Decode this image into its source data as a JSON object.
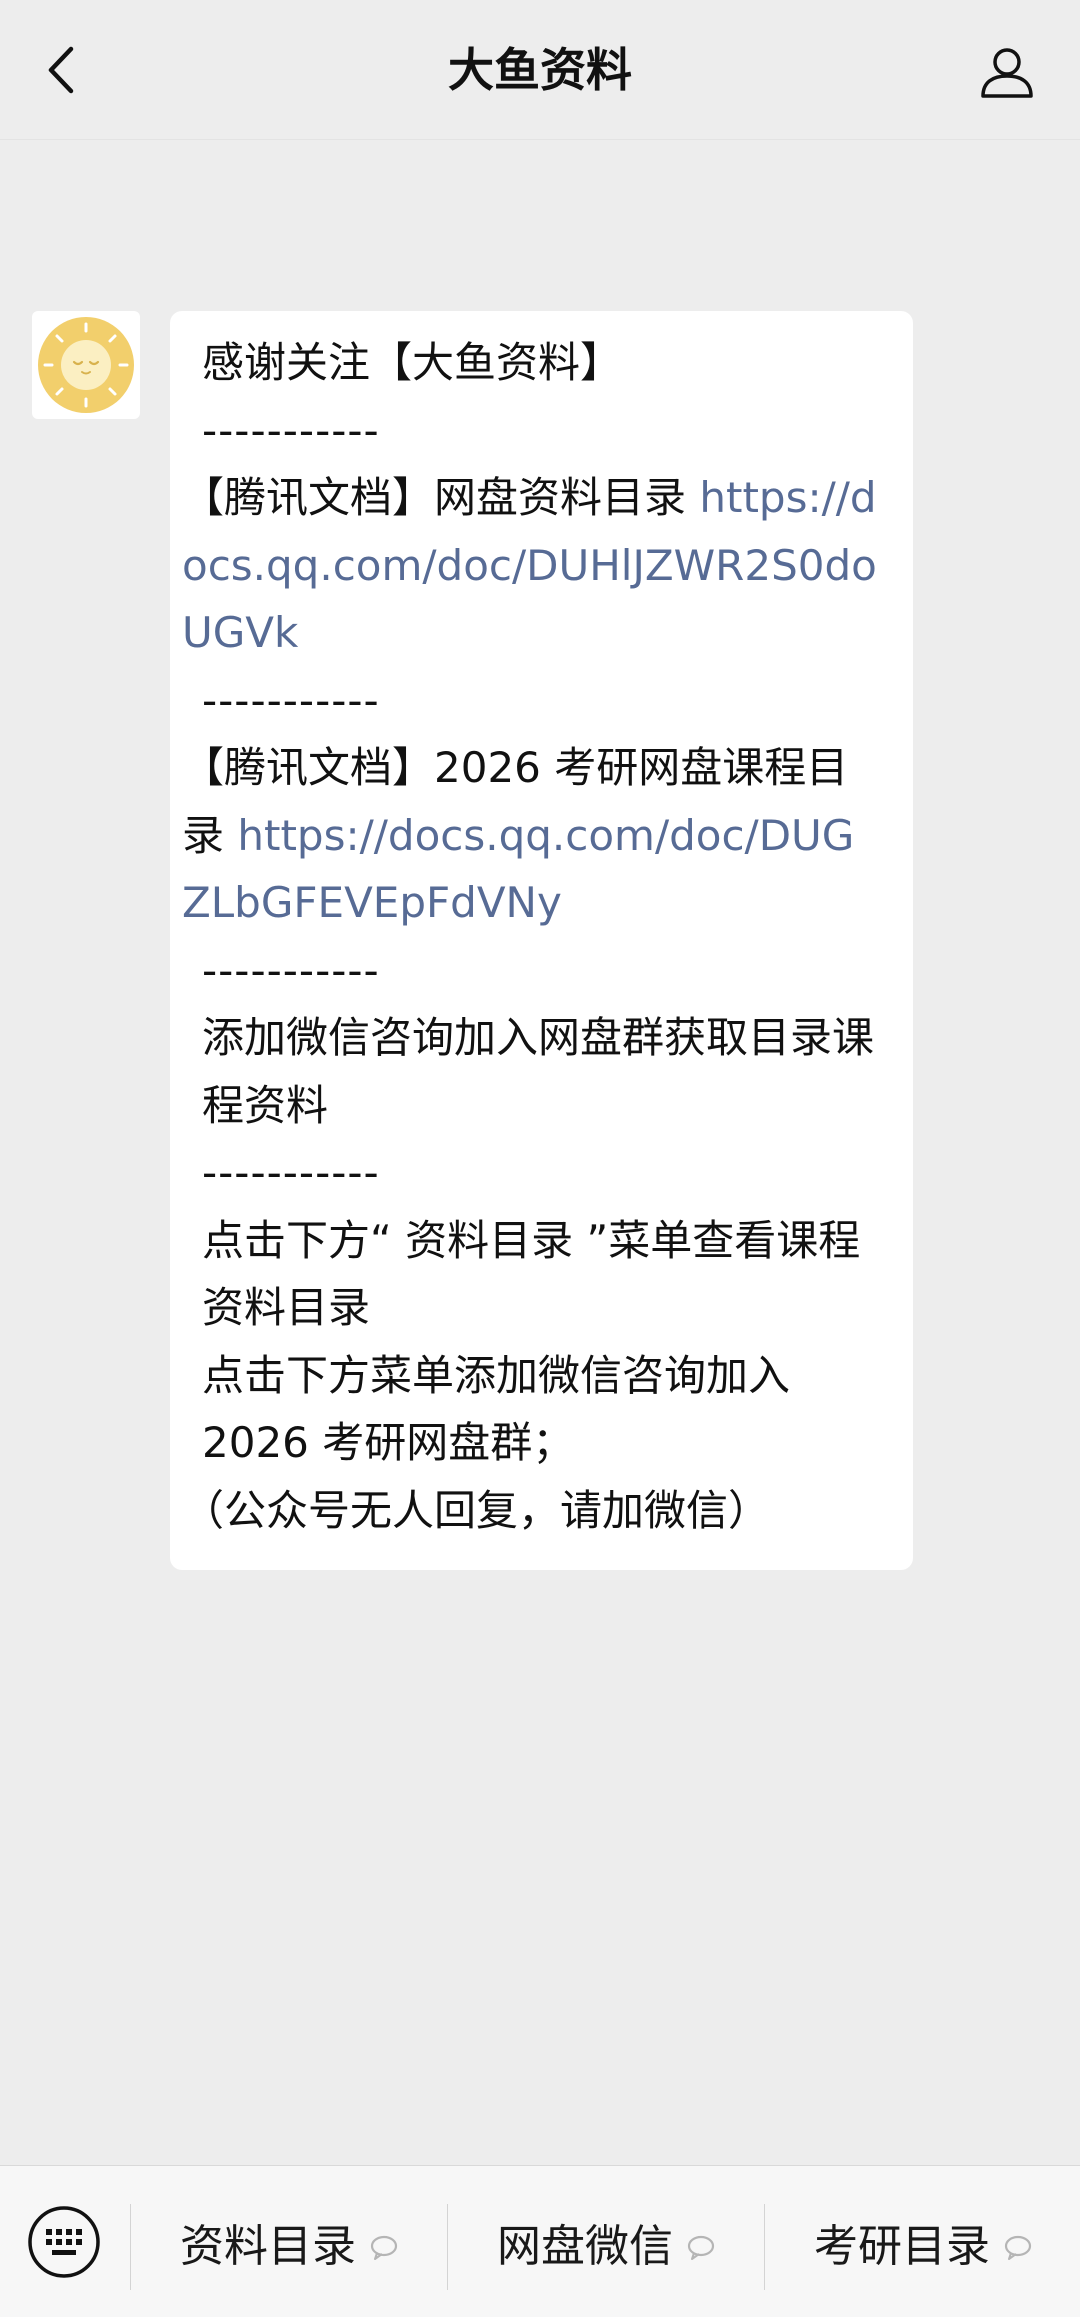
{
  "nav": {
    "title": "大鱼资料",
    "back_icon": "chevron-left-icon",
    "profile_icon": "person-icon"
  },
  "message": {
    "avatar_icon": "sun-face-icon",
    "lines": {
      "l1": "感谢关注【大鱼资料】",
      "sep1": "-----------",
      "l2_prefix": "【腾讯文档】网盘资料目录 ",
      "l2_link": "https://docs.qq.com/doc/DUHlJZWR2S0doUGVk",
      "sep2": "-----------",
      "l3_prefix": "【腾讯文档】2026 考研网盘课程目录 ",
      "l3_link": "https://docs.qq.com/doc/DUGZLbGFEVEpFdVNy",
      "sep3": "-----------",
      "l4": "添加微信咨询加入网盘群获取目录课程资料",
      "sep4": "-----------",
      "l5": "点击下方“ 资料目录 ”菜单查看课程资料目录",
      "l6": "点击下方菜单添加微信咨询加入2026 考研网盘群；",
      "l7": "（公众号无人回复，请加微信）"
    }
  },
  "bottom_menu": {
    "keyboard_icon": "keyboard-icon",
    "items": [
      {
        "label": "资料目录",
        "icon": "speech-bubble-icon"
      },
      {
        "label": "网盘微信",
        "icon": "speech-bubble-icon"
      },
      {
        "label": "考研目录",
        "icon": "speech-bubble-icon"
      }
    ]
  },
  "colors": {
    "background": "#ededed",
    "bubble": "#ffffff",
    "link": "#576b95",
    "avatar_sun": "#f2cf6c"
  }
}
